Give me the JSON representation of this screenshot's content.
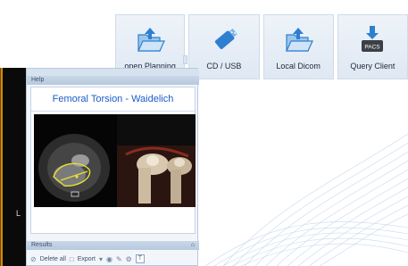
{
  "toolbar": {
    "tiles": [
      {
        "label": "open Planning",
        "icon": "folder-open-arrow-icon"
      },
      {
        "label": "CD / USB",
        "icon": "usb-drive-icon"
      },
      {
        "label": "Local Dicom",
        "icon": "folder-open-arrow-icon"
      },
      {
        "label": "Query Client",
        "icon": "pacs-download-icon"
      }
    ],
    "pacs_badge": "PACS"
  },
  "panel": {
    "help_label": "Help",
    "help_title": "Femoral Torsion - Waidelich",
    "results_label": "Results",
    "results_pin": "⌂",
    "results_toolbar": {
      "delete_all": "Delete all",
      "export": "Export",
      "export_caret": "▾",
      "text_tool": "T"
    }
  },
  "left_strip_letter": "L",
  "colors": {
    "accent": "#1c5cc8",
    "icon_blue": "#2f7fd1",
    "tile_bg": "#e6edf6"
  }
}
